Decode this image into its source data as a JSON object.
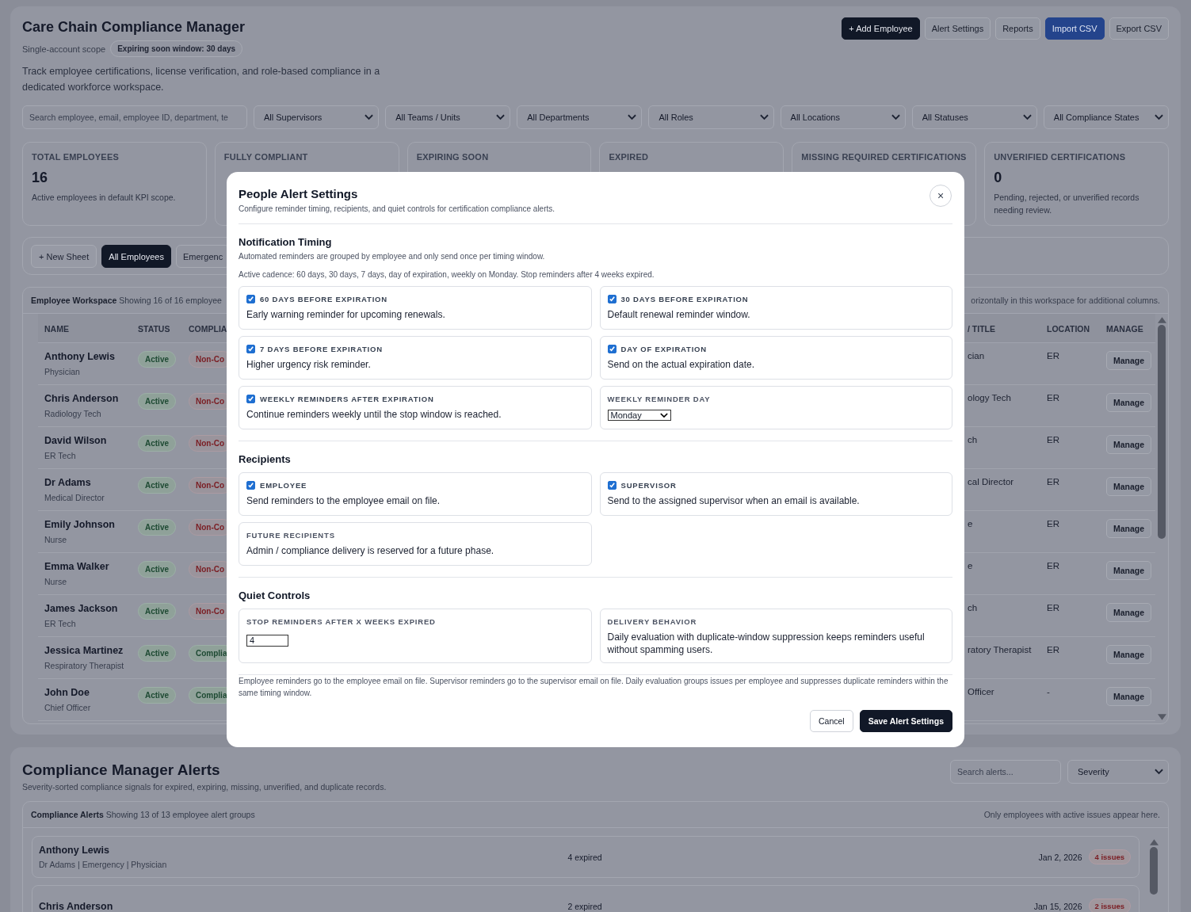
{
  "app": {
    "title": "Care Chain Compliance Manager",
    "scope": "Single-account scope",
    "window_pill": "Expiring soon window:  30  days",
    "description": "Track employee certifications, license verification, and role-based compliance in a dedicated workforce workspace."
  },
  "actions": [
    {
      "label": "+ Add Employee",
      "kind": "dark"
    },
    {
      "label": "Alert Settings",
      "kind": "outline"
    },
    {
      "label": "Reports",
      "kind": "outline"
    },
    {
      "label": "Import CSV",
      "kind": "blue"
    },
    {
      "label": "Export CSV",
      "kind": "outline"
    }
  ],
  "filters": {
    "search_placeholder": "Search employee, email, employee ID, department, te",
    "selects": [
      "All Supervisors",
      "All Teams / Units",
      "All Departments",
      "All Roles",
      "All Locations",
      "All Statuses",
      "All Compliance States"
    ]
  },
  "kpis": [
    {
      "label": "TOTAL EMPLOYEES",
      "value": "16",
      "description": "Active employees in default KPI scope."
    },
    {
      "label": "FULLY COMPLIANT"
    },
    {
      "label": "EXPIRING SOON"
    },
    {
      "label": "EXPIRED"
    },
    {
      "label": "MISSING REQUIRED CERTIFICATIONS"
    },
    {
      "label": "UNVERIFIED CERTIFICATIONS",
      "value": "0",
      "description": "Pending, rejected, or unverified records needing review."
    }
  ],
  "sheets": [
    {
      "label": "+ New Sheet",
      "kind": "new",
      "selected": false
    },
    {
      "label": "All Employees",
      "kind": "sheet",
      "selected": true
    },
    {
      "label": "Emergenc",
      "kind": "sheet",
      "selected": false
    }
  ],
  "workspace": {
    "title": "Employee Workspace",
    "summary": "Showing 16 of 16 employee",
    "hint": "orizontally in this workspace for additional columns.",
    "columns_left": [
      "NAME",
      "STATUS",
      "COMPLIA"
    ],
    "columns_right": [
      "/ TITLE",
      "LOCATION",
      "MANAGE"
    ],
    "rows": [
      {
        "name": "Anthony Lewis",
        "role": "Physician",
        "status": "Active",
        "compliance": "Non-Co",
        "kind": "non_compliant",
        "title": "cian",
        "location": "ER",
        "action": "Manage"
      },
      {
        "name": "Chris Anderson",
        "role": "Radiology Tech",
        "status": "Active",
        "compliance": "Non-Co",
        "kind": "non_compliant",
        "title": "ology Tech",
        "location": "ER",
        "action": "Manage"
      },
      {
        "name": "David Wilson",
        "role": "ER Tech",
        "status": "Active",
        "compliance": "Non-Co",
        "kind": "non_compliant",
        "title": "ch",
        "location": "ER",
        "action": "Manage"
      },
      {
        "name": "Dr Adams",
        "role": "Medical Director",
        "status": "Active",
        "compliance": "Non-Co",
        "kind": "non_compliant",
        "title": "cal Director",
        "location": "ER",
        "action": "Manage"
      },
      {
        "name": "Emily Johnson",
        "role": "Nurse",
        "status": "Active",
        "compliance": "Non-Co",
        "kind": "non_compliant",
        "title": "e",
        "location": "ER",
        "action": "Manage"
      },
      {
        "name": "Emma Walker",
        "role": "Nurse",
        "status": "Active",
        "compliance": "Non-Co",
        "kind": "non_compliant",
        "title": "e",
        "location": "ER",
        "action": "Manage"
      },
      {
        "name": "James Jackson",
        "role": "ER Tech",
        "status": "Active",
        "compliance": "Non-Co",
        "kind": "non_compliant",
        "title": "ch",
        "location": "ER",
        "action": "Manage"
      },
      {
        "name": "Jessica Martinez",
        "role": "Respiratory Therapist",
        "status": "Active",
        "compliance": "Complia",
        "kind": "compliant",
        "title": "ratory Therapist",
        "location": "ER",
        "action": "Manage"
      },
      {
        "name": "John Doe",
        "role": "Chief Officer",
        "status": "Active",
        "compliance": "Complia",
        "kind": "compliant",
        "title": "Officer",
        "location": "-",
        "action": "Manage"
      }
    ]
  },
  "alerts": {
    "title": "Compliance Manager Alerts",
    "subtitle": "Severity-sorted compliance signals for expired, expiring, missing, unverified, and duplicate records.",
    "search_placeholder": "Search alerts...",
    "severity": "Severity",
    "panel_title": "Compliance Alerts",
    "summary": "Showing 13 of 13 employee alert groups",
    "note": "Only employees with active issues appear here.",
    "rows": [
      {
        "name": "Anthony Lewis",
        "meta": "Dr Adams | Emergency | Physician",
        "summary": "4 expired",
        "date": "Jan 2, 2026",
        "badge": "4 issues"
      },
      {
        "name": "Chris Anderson",
        "summary": "2 expired",
        "date": "Jan 15, 2026",
        "badge": "2 issues"
      }
    ]
  },
  "modal": {
    "title": "People Alert Settings",
    "subtitle": "Configure reminder timing, recipients, and quiet controls for certification compliance alerts.",
    "close": "×",
    "sections": [
      {
        "title": "Notification Timing",
        "description": "Automated reminders are grouped by employee and only send once per timing window.",
        "note": "Active cadence: 60 days, 30 days, 7 days, day of expiration, weekly on Monday. Stop reminders after 4 weeks expired.",
        "options": [
          {
            "kind": "checkbox",
            "label": "60 DAYS BEFORE EXPIRATION",
            "description": "Early warning reminder for upcoming renewals.",
            "checked": true
          },
          {
            "kind": "checkbox",
            "label": "30 DAYS BEFORE EXPIRATION",
            "description": "Default renewal reminder window.",
            "checked": true
          },
          {
            "kind": "checkbox",
            "label": "7 DAYS BEFORE EXPIRATION",
            "description": "Higher urgency risk reminder.",
            "checked": true
          },
          {
            "kind": "checkbox",
            "label": "DAY OF EXPIRATION",
            "description": "Send on the actual expiration date.",
            "checked": true
          },
          {
            "kind": "checkbox",
            "label": "WEEKLY REMINDERS AFTER EXPIRATION",
            "description": "Continue reminders weekly until the stop window is reached.",
            "checked": true
          },
          {
            "kind": "select",
            "label": "WEEKLY REMINDER DAY",
            "value": "Monday"
          }
        ]
      },
      {
        "title": "Recipients",
        "options": [
          {
            "kind": "checkbox",
            "label": "EMPLOYEE",
            "description": "Send reminders to the employee email on file.",
            "checked": true
          },
          {
            "kind": "checkbox",
            "label": "SUPERVISOR",
            "description": "Send to the assigned supervisor when an email is available.",
            "checked": true
          },
          {
            "kind": "info",
            "label": "FUTURE RECIPIENTS",
            "description": "Admin / compliance delivery is reserved for a future phase."
          }
        ]
      },
      {
        "title": "Quiet Controls",
        "options": [
          {
            "kind": "number",
            "label": "STOP REMINDERS AFTER X WEEKS EXPIRED",
            "value": "4"
          },
          {
            "kind": "info",
            "label": "DELIVERY BEHAVIOR",
            "description": "Daily evaluation with duplicate-window suppression keeps reminders useful without spamming users."
          }
        ]
      }
    ],
    "footnote": "Employee reminders go to the employee email on file. Supervisor reminders go to the supervisor email on file. Daily evaluation groups issues per employee and suppresses duplicate reminders within the same timing window.",
    "buttons": [
      {
        "label": "Cancel",
        "kind": "secondary"
      },
      {
        "label": "Save Alert Settings",
        "kind": "primary"
      }
    ]
  }
}
